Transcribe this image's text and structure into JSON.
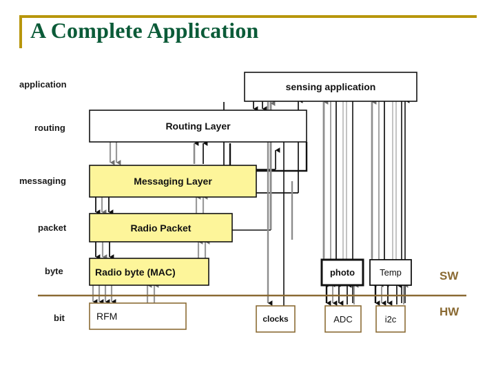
{
  "slide": {
    "title": "A Complete Application",
    "title_color": "#0b5b38",
    "accent_color": "#b8960c"
  },
  "diagram": {
    "divider": {
      "label_sw": "SW",
      "label_hw": "HW",
      "color": "#8a6a33"
    },
    "row_labels": [
      {
        "id": "application",
        "text": "application"
      },
      {
        "id": "routing",
        "text": "routing"
      },
      {
        "id": "messaging",
        "text": "messaging"
      },
      {
        "id": "packet",
        "text": "packet"
      },
      {
        "id": "byte",
        "text": "byte"
      },
      {
        "id": "bit",
        "text": "bit"
      }
    ],
    "boxes": [
      {
        "id": "sensing-application",
        "label": "sensing application",
        "fill": "#ffffff",
        "stroke": "#000000"
      },
      {
        "id": "routing-layer",
        "label": "Routing Layer",
        "fill": "#ffffff",
        "stroke": "#000000"
      },
      {
        "id": "messaging-layer",
        "label": "Messaging Layer",
        "fill": "#fdf59a",
        "stroke": "#000000"
      },
      {
        "id": "radio-packet",
        "label": "Radio Packet",
        "fill": "#fdf59a",
        "stroke": "#000000"
      },
      {
        "id": "radio-byte-mac",
        "label": "Radio byte (MAC)",
        "fill": "#fdf59a",
        "stroke": "#000000"
      },
      {
        "id": "rfm",
        "label": "RFM",
        "fill": "#ffffff",
        "stroke": "#8a6a33"
      },
      {
        "id": "photo",
        "label": "photo",
        "fill": "#ffffff",
        "stroke": "#000000"
      },
      {
        "id": "temp",
        "label": "Temp",
        "fill": "#ffffff",
        "stroke": "#000000"
      },
      {
        "id": "clocks",
        "label": "clocks",
        "fill": "#ffffff",
        "stroke": "#8a6a33"
      },
      {
        "id": "adc",
        "label": "ADC",
        "fill": "#ffffff",
        "stroke": "#8a6a33"
      },
      {
        "id": "i2c",
        "label": "i2c",
        "fill": "#ffffff",
        "stroke": "#8a6a33"
      }
    ]
  }
}
